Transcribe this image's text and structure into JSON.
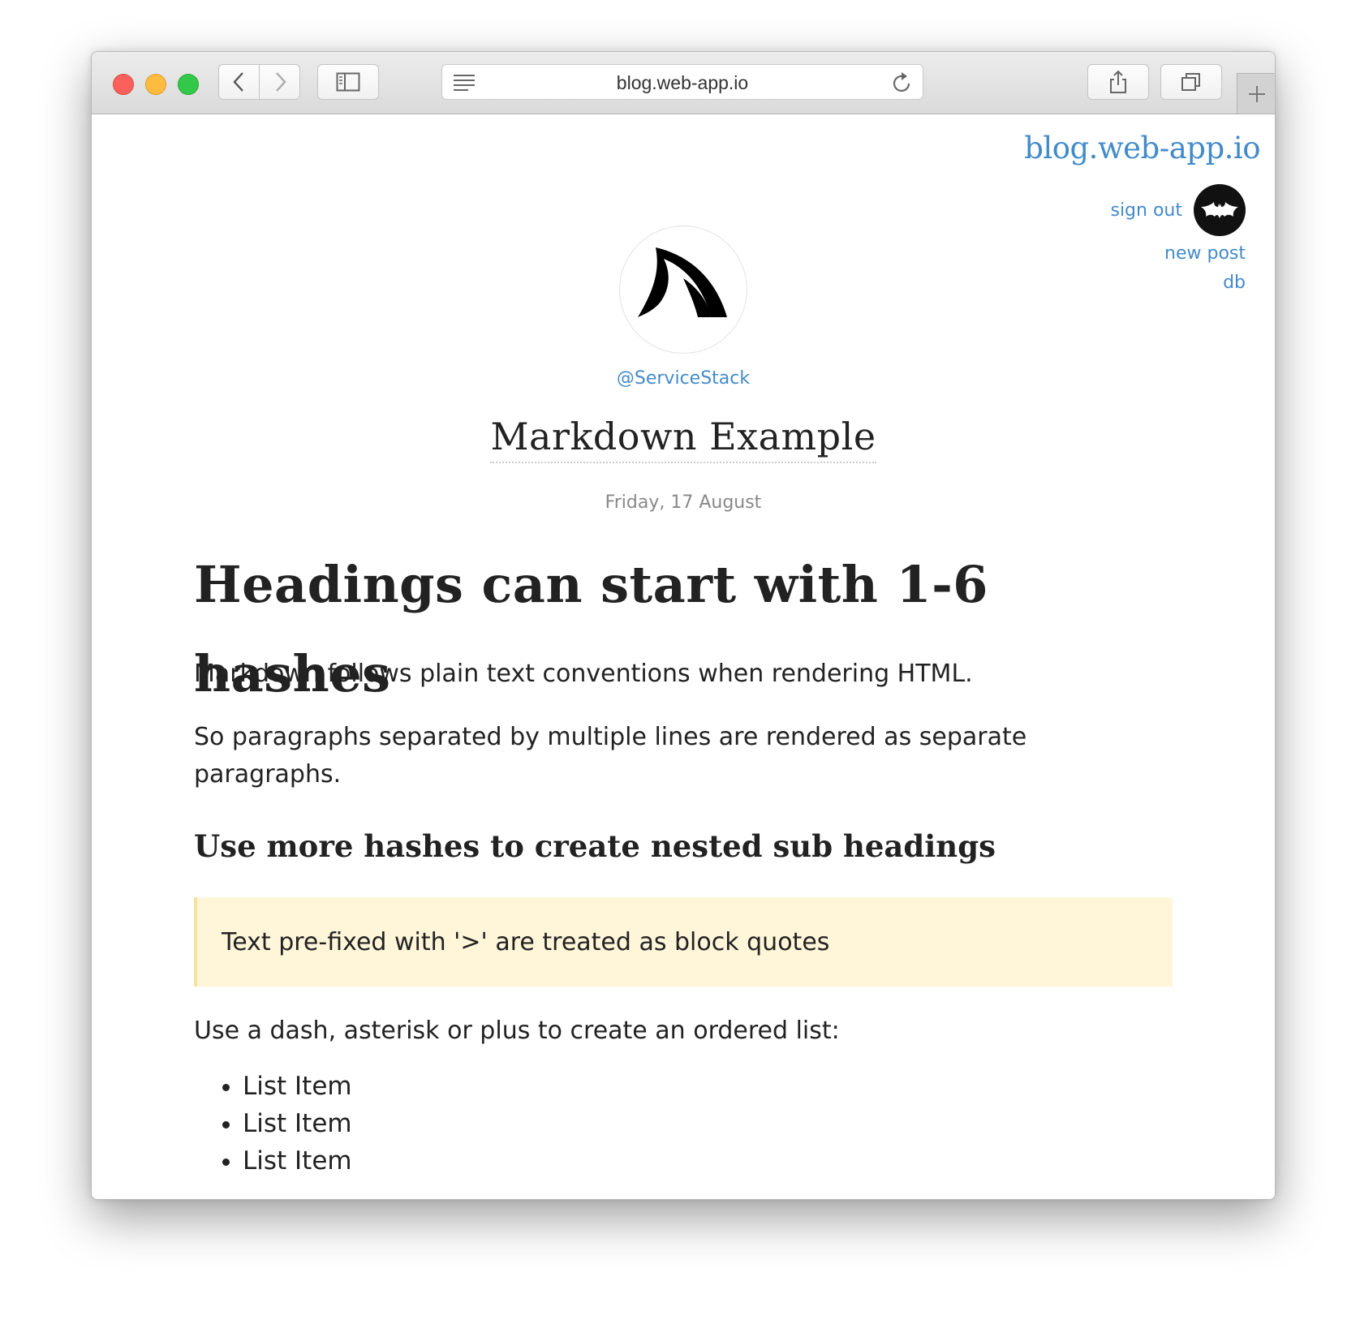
{
  "browser": {
    "url": "blog.web-app.io"
  },
  "header": {
    "site_title": "blog.web-app.io",
    "sign_out": "sign out",
    "new_post": "new post",
    "db": "db"
  },
  "profile": {
    "handle": "@ServiceStack"
  },
  "post": {
    "title": "Markdown Example",
    "date": "Friday, 17 August",
    "heading1": "Headings can start with 1-6 hashes",
    "paragraph1": "Markdown follows plain text conventions when rendering HTML.",
    "paragraph2": "So paragraphs separated by multiple lines are rendered as separate paragraphs.",
    "heading2": "Use more hashes to create nested sub headings",
    "blockquote": "Text pre-fixed with '>' are treated as block quotes",
    "paragraph3": "Use a dash, asterisk or plus to create an ordered list:",
    "list_items": [
      "List Item",
      "List Item",
      "List Item"
    ]
  },
  "colors": {
    "link": "#428bca",
    "blockquote_bg": "#fff6da",
    "blockquote_border": "#f6e29a",
    "traffic_close": "#fc605b",
    "traffic_minimize": "#fdbc40",
    "traffic_maximize": "#34c84a"
  }
}
